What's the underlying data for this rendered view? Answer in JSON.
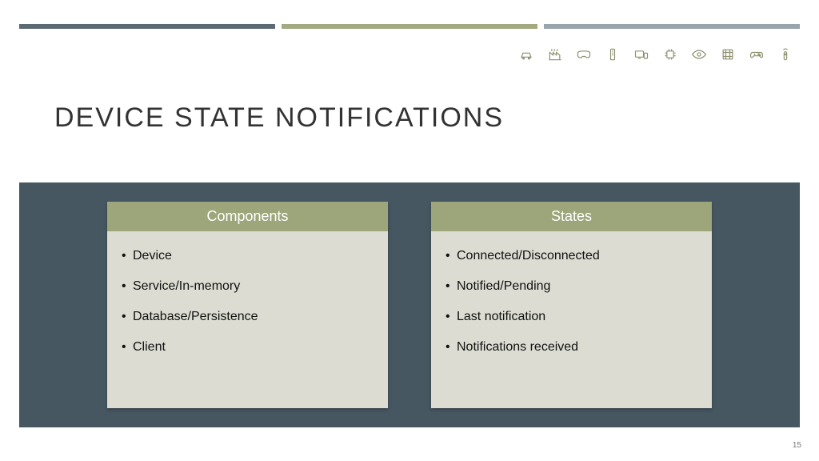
{
  "title": "DEVICE STATE NOTIFICATIONS",
  "page_number": "15",
  "icons": [
    "car-icon",
    "factory-icon",
    "vr-headset-icon",
    "server-icon",
    "devices-icon",
    "chip-icon",
    "eye-icon",
    "film-icon",
    "gamepad-icon",
    "remote-icon"
  ],
  "cards": [
    {
      "header": "Components",
      "items": [
        "Device",
        "Service/In-memory",
        "Database/Persistence",
        "Client"
      ]
    },
    {
      "header": "States",
      "items": [
        "Connected/Disconnected",
        "Notified/Pending",
        "Last notification",
        "Notifications received"
      ]
    }
  ]
}
